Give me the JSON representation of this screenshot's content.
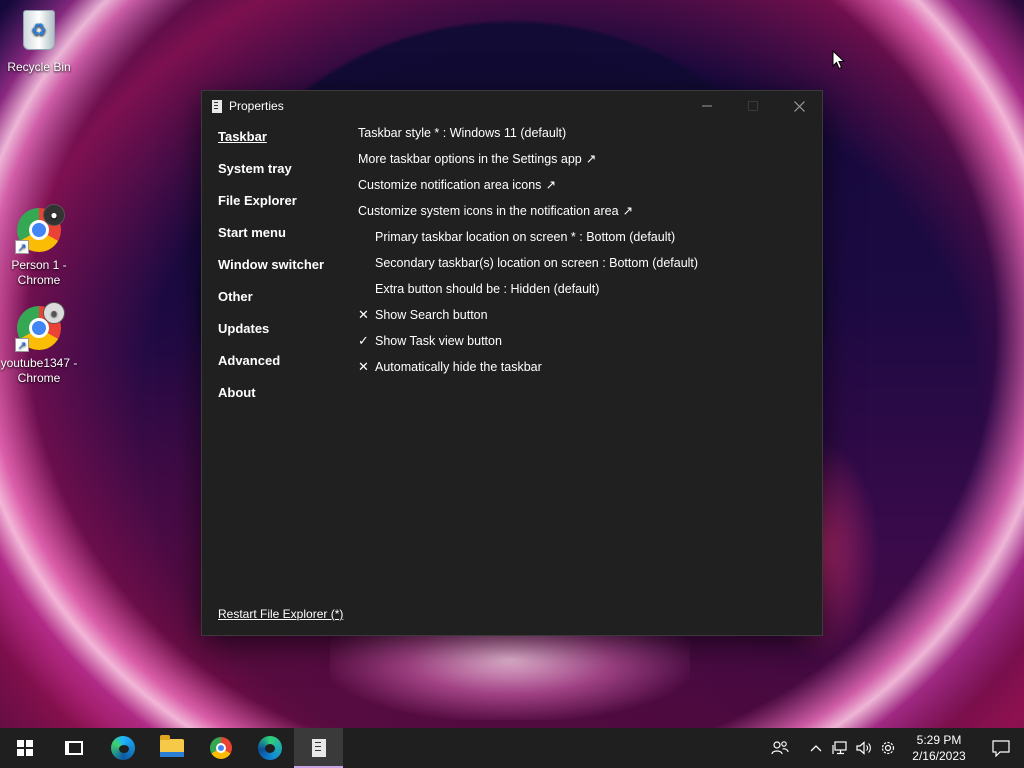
{
  "desktop": {
    "icons": [
      {
        "label": "Recycle Bin"
      },
      {
        "label": "Person 1 - Chrome"
      },
      {
        "label": "youtube1347 - Chrome"
      }
    ]
  },
  "window": {
    "title": "Properties",
    "nav": [
      {
        "label": "Taskbar",
        "active": true
      },
      {
        "label": "System tray"
      },
      {
        "label": "File Explorer"
      },
      {
        "label": "Start menu"
      },
      {
        "label": "Window switcher"
      },
      {
        "label": "Other"
      },
      {
        "label": "Updates"
      },
      {
        "label": "Advanced"
      },
      {
        "label": "About"
      }
    ],
    "settings": [
      {
        "text": "Taskbar style * : Windows 11 (default)"
      },
      {
        "text": "More taskbar options in the Settings app",
        "arrow": "↗"
      },
      {
        "text": "Customize notification area icons",
        "arrow": "↗"
      },
      {
        "text": "Customize system icons in the notification area",
        "arrow": "↗"
      },
      {
        "text": "Primary taskbar location on screen * : Bottom (default)"
      },
      {
        "text": "Secondary taskbar(s) location on screen : Bottom (default)"
      },
      {
        "text": "Extra button should be : Hidden (default)"
      },
      {
        "text": "Show Search button",
        "mark": "✕"
      },
      {
        "text": "Show Task view button",
        "mark": "✓"
      },
      {
        "text": "Automatically hide the taskbar",
        "mark": "✕"
      }
    ],
    "restart_link": "Restart File Explorer (*)"
  },
  "taskbar": {
    "clock_time": "5:29 PM",
    "clock_date": "2/16/2023"
  }
}
